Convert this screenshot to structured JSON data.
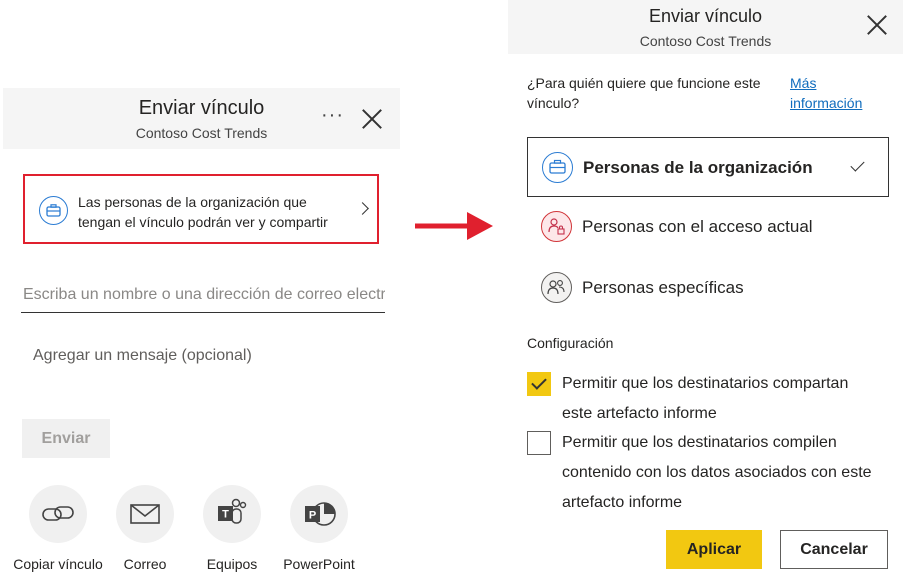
{
  "left_dialog": {
    "title": "Enviar vínculo",
    "subtitle": "Contoso Cost Trends",
    "more_label": "···",
    "access_summary": "Las personas de la organización que tengan el vínculo podrán ver y compartir",
    "email_placeholder": "Escriba un nombre o una dirección de correo electrónico",
    "message_placeholder": "Agregar un mensaje (opcional)",
    "send_label": "Enviar",
    "share_options": [
      {
        "label": "Copiar vínculo",
        "icon": "link-icon"
      },
      {
        "label": "Correo",
        "icon": "mail-icon"
      },
      {
        "label": "Equipos",
        "icon": "teams-icon"
      },
      {
        "label": "PowerPoint",
        "icon": "powerpoint-icon"
      }
    ]
  },
  "arrow": {
    "color": "#e0202e"
  },
  "right_dialog": {
    "title": "Enviar vínculo",
    "subtitle": "Contoso Cost Trends",
    "question": "¿Para quién quiere que funcione este vínculo?",
    "more_info_link": "Más información",
    "options": [
      {
        "label": "Personas de la organización",
        "selected": true,
        "icon": "briefcase-icon"
      },
      {
        "label": "Personas con el acceso actual",
        "selected": false,
        "icon": "people-lock-icon"
      },
      {
        "label": "Personas específicas",
        "selected": false,
        "icon": "people-icon"
      }
    ],
    "settings_title": "Configuración",
    "settings": [
      {
        "label": "Permitir que los destinatarios compartan este artefacto informe",
        "checked": true
      },
      {
        "label": "Permitir que los destinatarios compilen contenido con los datos asociados con este artefacto informe",
        "checked": false
      }
    ],
    "apply_label": "Aplicar",
    "cancel_label": "Cancelar"
  },
  "colors": {
    "accent_yellow": "#f2c811",
    "highlight_red": "#e0202e",
    "link_blue": "#0f6cbd"
  }
}
